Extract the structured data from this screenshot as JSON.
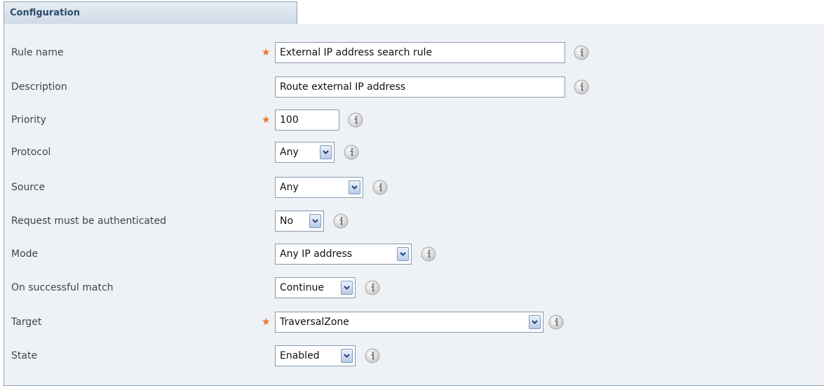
{
  "panel": {
    "title": "Configuration"
  },
  "fields": {
    "rule_name": {
      "label": "Rule name",
      "required_mark": "★",
      "value": "External IP address search rule",
      "info_icon": "info-icon"
    },
    "description": {
      "label": "Description",
      "value": "Route external IP address",
      "info_icon": "info-icon"
    },
    "priority": {
      "label": "Priority",
      "required_mark": "★",
      "value": "100",
      "info_icon": "info-icon"
    },
    "protocol": {
      "label": "Protocol",
      "selected": "Any",
      "info_icon": "info-icon"
    },
    "source": {
      "label": "Source",
      "selected": "Any",
      "info_icon": "info-icon"
    },
    "authenticated": {
      "label": "Request must be authenticated",
      "selected": "No",
      "info_icon": "info-icon"
    },
    "mode": {
      "label": "Mode",
      "selected": "Any IP address",
      "info_icon": "info-icon"
    },
    "on_match": {
      "label": "On successful match",
      "selected": "Continue",
      "info_icon": "info-icon"
    },
    "target": {
      "label": "Target",
      "required_mark": "★",
      "selected": "TraversalZone",
      "info_icon": "info-icon"
    },
    "state": {
      "label": "State",
      "selected": "Enabled",
      "info_icon": "info-icon"
    }
  },
  "colors": {
    "panel_bg": "#eef2f6",
    "border": "#8fa3b5",
    "header_text": "#2b4a69",
    "required_star": "#e8742a"
  }
}
